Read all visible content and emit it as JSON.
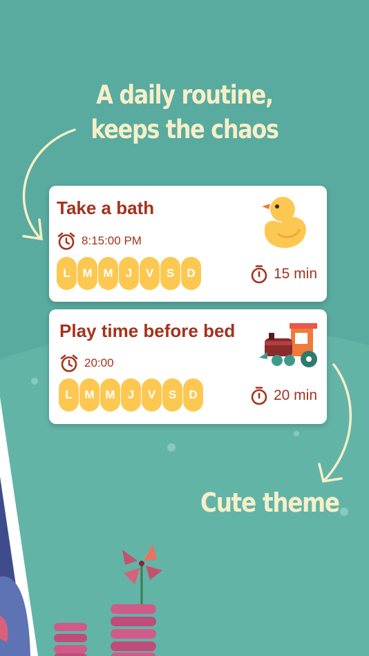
{
  "headline": {
    "line1": "A daily routine,",
    "line2": "keeps the chaos"
  },
  "tasks": [
    {
      "title": "Take a bath",
      "alarm_time": "8:15:00 PM",
      "days": [
        "L",
        "M",
        "M",
        "J",
        "V",
        "S",
        "D"
      ],
      "duration": "15 min",
      "icon": "rubber-duck-icon"
    },
    {
      "title": "Play time before bed",
      "alarm_time": "20:00",
      "days": [
        "L",
        "M",
        "M",
        "J",
        "V",
        "S",
        "D"
      ],
      "duration": "20 min",
      "icon": "toy-train-icon"
    }
  ],
  "theme_caption": "Cute theme",
  "colors": {
    "background": "#58ab9e",
    "accent_text": "#a4321c",
    "day_pill": "#fdc852",
    "headline_text": "#f6efc9"
  }
}
